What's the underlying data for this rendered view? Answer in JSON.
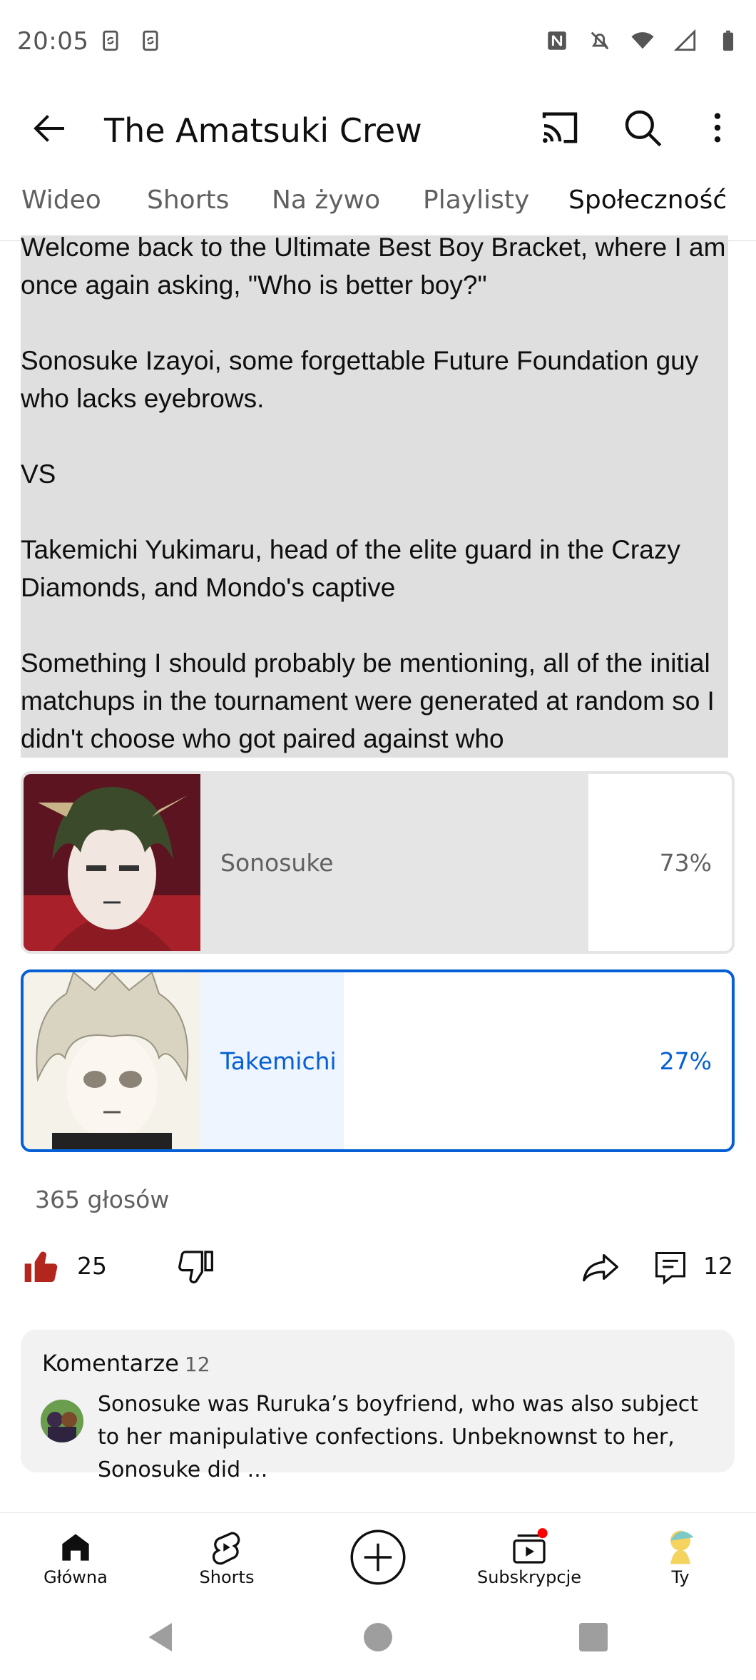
{
  "status_bar": {
    "time": "20:05",
    "left_icons": [
      "sync-icon",
      "sync-icon"
    ],
    "right_icons": [
      "nfc-icon",
      "mute-icon",
      "wifi-icon",
      "signal-icon",
      "battery-icon"
    ]
  },
  "app_bar": {
    "title": "The Amatsuki Crew",
    "actions": [
      "cast-icon",
      "search-icon",
      "more-vert-icon"
    ]
  },
  "tabs": [
    {
      "label": "Wideo",
      "active": false
    },
    {
      "label": "Shorts",
      "active": false
    },
    {
      "label": "Na żywo",
      "active": false
    },
    {
      "label": "Playlisty",
      "active": false
    },
    {
      "label": "Społeczność",
      "active": true
    }
  ],
  "post": {
    "text": "Welcome back to the Ultimate Best Boy Bracket, where I am once again asking, \"Who is better boy?\"\n\nSonosuke Izayoi, some forgettable Future Foundation guy who lacks eyebrows.\n\nVS\n\nTakemichi Yukimaru, head of the elite guard in the Crazy Diamonds, and Mondo's captive\n\nSomething I should probably be mentioning, all of the initial matchups in the tournament were generated at random so I didn't choose who got paired against who"
  },
  "poll": {
    "options": [
      {
        "label": "Sonosuke",
        "percent": "73%",
        "fraction": 0.73,
        "selected": false
      },
      {
        "label": "Takemichi",
        "percent": "27%",
        "fraction": 0.27,
        "selected": true
      }
    ],
    "votes": "365 głosów"
  },
  "actions": {
    "likes": "25",
    "comments": "12"
  },
  "comments_card": {
    "heading": "Komentarze",
    "count": "12",
    "top_comment": "Sonosuke was Ruruka’s boyfriend, who was also subject to her manipulative confections. Unbeknownst to her, Sonosuke did ..."
  },
  "bottom_nav": [
    {
      "label": "Główna",
      "icon": "home-icon"
    },
    {
      "label": "Shorts",
      "icon": "shorts-icon"
    },
    {
      "label": "",
      "icon": "create-icon"
    },
    {
      "label": "Subskrypcje",
      "icon": "subscriptions-icon"
    },
    {
      "label": "Ty",
      "icon": "avatar-icon"
    }
  ],
  "colors": {
    "accent_blue": "#065fd4",
    "like_red": "#b3261e",
    "post_bg": "#dfdfdf"
  }
}
